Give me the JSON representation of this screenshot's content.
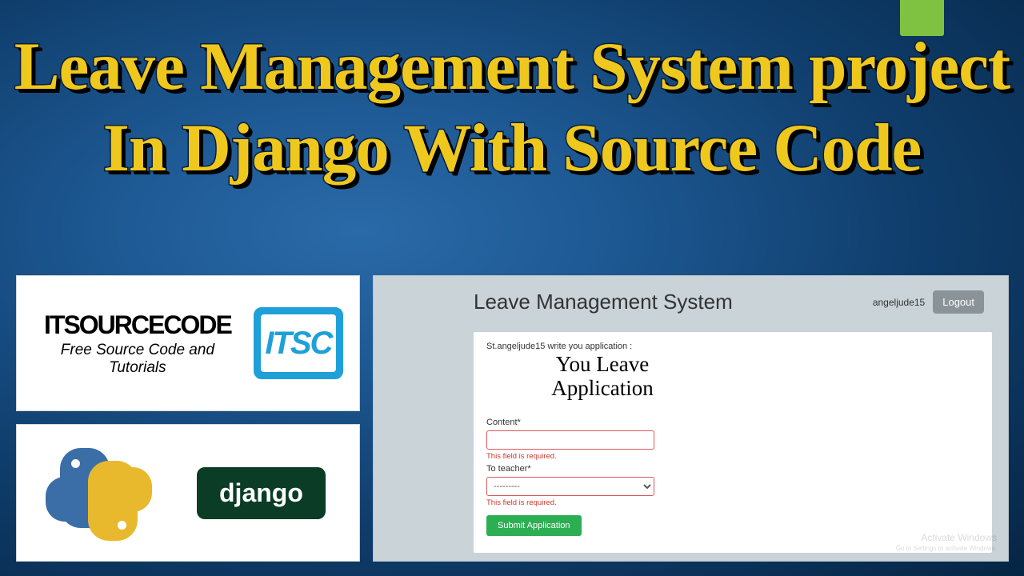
{
  "banner": {
    "line1": "Leave Management System project",
    "line2": "In Django With Source Code"
  },
  "logo": {
    "name": "ITSOURCECODE",
    "tagline": "Free Source Code and Tutorials",
    "badge": "ITSC"
  },
  "tech": {
    "django": "django"
  },
  "app": {
    "title": "Leave Management System",
    "username": "angeljude15",
    "logout": "Logout",
    "prompt": "St.angeljude15 write you application :",
    "heading": "You Leave Application",
    "fields": {
      "content": {
        "label": "Content*",
        "required_err": "This field is required."
      },
      "teacher": {
        "label": "To teacher*",
        "placeholder": "---------",
        "required_err": "This field is required."
      }
    },
    "submit": "Submit Application"
  },
  "watermark": {
    "l1": "Activate Windows",
    "l2": "Go to Settings to activate Windows."
  }
}
